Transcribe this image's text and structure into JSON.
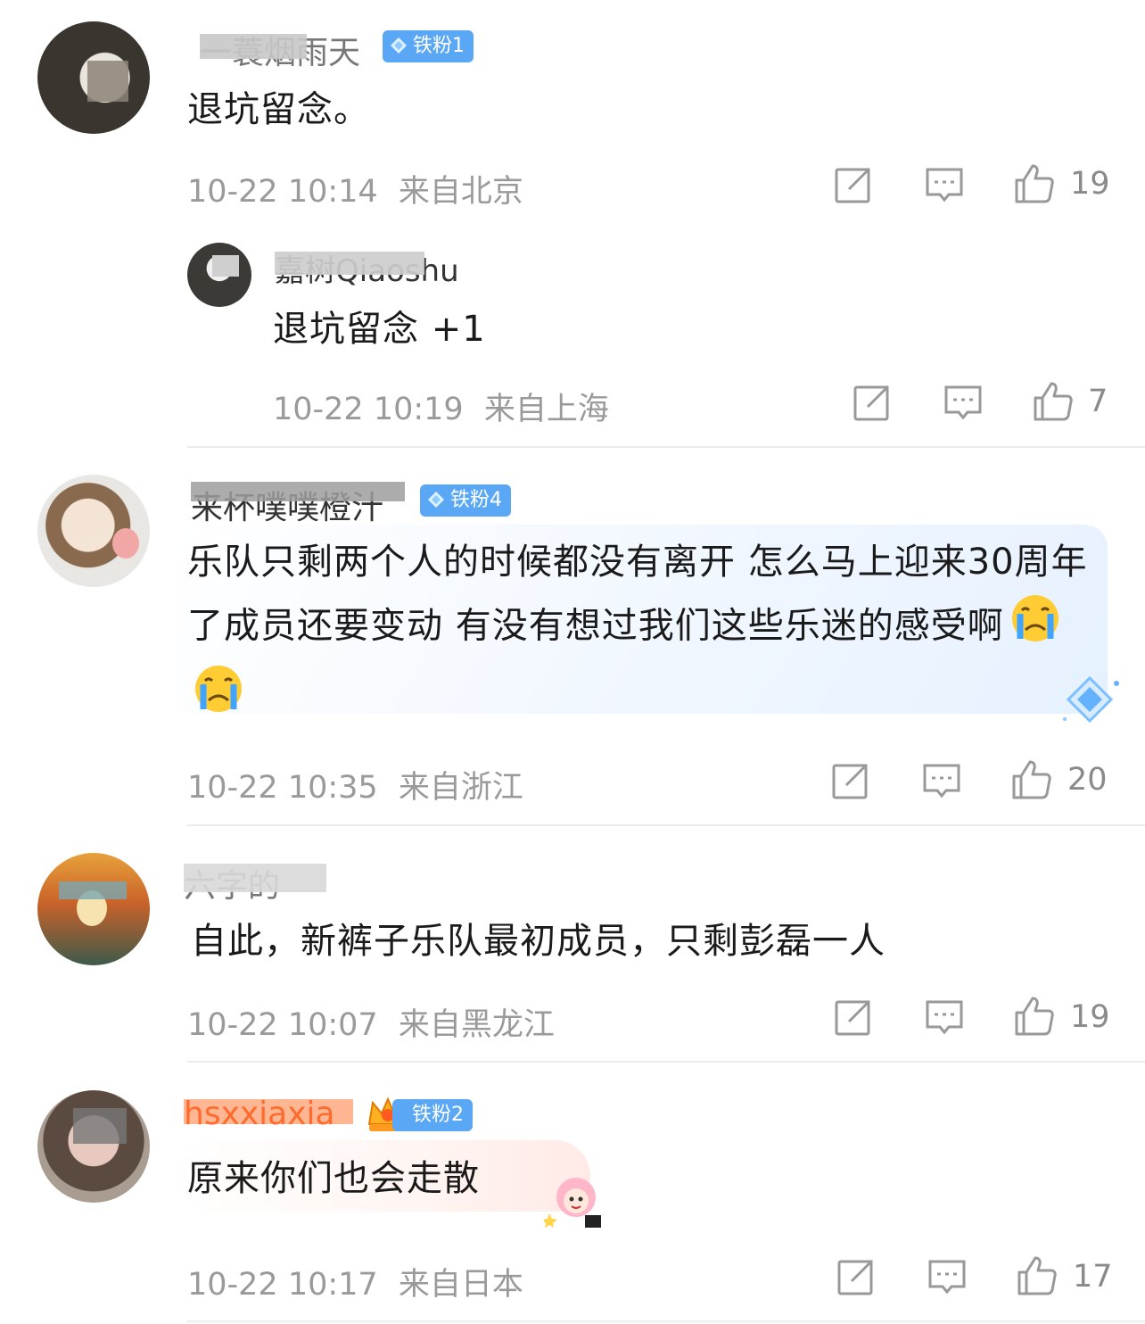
{
  "comments": [
    {
      "username": "一蓑烟雨天",
      "badge": "铁粉1",
      "content": "退坑留念。",
      "time": "10-22 10:14",
      "location": "来自北京",
      "likes": "19",
      "reply": {
        "username": "嘉树Qiaoshu",
        "content": "退坑留念 +1",
        "time": "10-22 10:19",
        "location": "来自上海",
        "likes": "7"
      }
    },
    {
      "username": "来杯噗噗橙汁",
      "badge": "铁粉4",
      "content": "乐队只剩两个人的时候都没有离开 怎么马上迎来30周年了成员还要变动 有没有想过我们这些乐迷的感受啊",
      "emoji": "crying-face-emoji",
      "time": "10-22 10:35",
      "location": "来自浙江",
      "likes": "20"
    },
    {
      "username": "六字的",
      "content": "自此，新裤子乐队最初成员，只剩彭磊一人",
      "time": "10-22 10:07",
      "location": "来自黑龙江",
      "likes": "19"
    },
    {
      "username": "hsxxiaxia",
      "badge": "铁粉2",
      "content": "原来你们也会走散",
      "time": "10-22 10:17",
      "location": "来自日本",
      "likes": "17"
    }
  ],
  "colors": {
    "badge": "#5aa8f5",
    "meta": "#9a9a9a",
    "orange_name": "#ff5a1f"
  }
}
